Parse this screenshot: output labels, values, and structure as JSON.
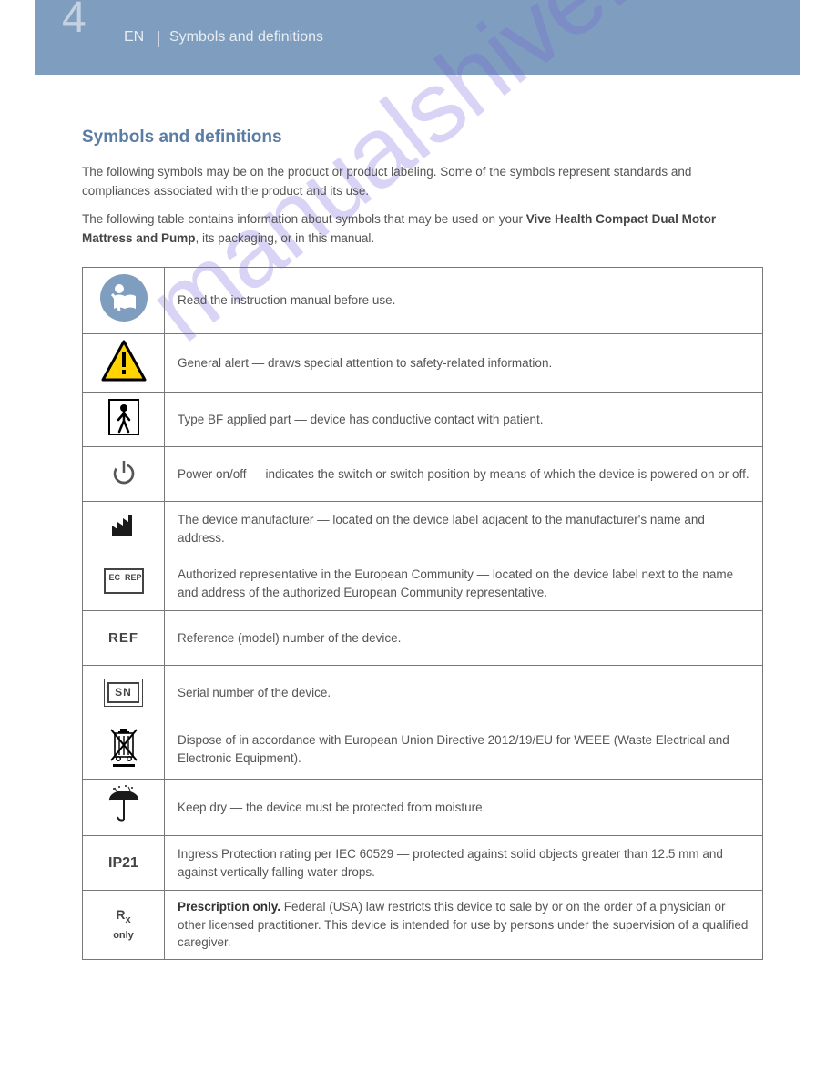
{
  "header": {
    "page_number": "4",
    "left": "EN",
    "right": "Symbols and definitions"
  },
  "intro": {
    "title": "Symbols and definitions",
    "para1": "The following symbols may be on the product or product labeling. Some of the symbols represent standards and compliances associated with the product and its use.",
    "para2_prefix": "The following table contains information about symbols that may be used on your ",
    "product_strong": "Vive Health Compact Dual Motor Mattress and Pump",
    "para2_suffix": ", its packaging, or in this manual."
  },
  "rows": [
    {
      "icon": "manual",
      "text": "Read the instruction manual before use."
    },
    {
      "icon": "alert",
      "text": "General alert — draws special attention to safety-related information."
    },
    {
      "icon": "bf",
      "text": "Type BF applied part — device has conductive contact with patient."
    },
    {
      "icon": "power",
      "text": "Power on/off — indicates the switch or switch position by means of which the device is powered on or off."
    },
    {
      "icon": "mfg",
      "text": "The device manufacturer — located on the device label adjacent to the manufacturer's name and address."
    },
    {
      "icon": "ecrep",
      "text": "Authorized representative in the European Community — located on the device label next to the name and address of the authorized European Community representative."
    },
    {
      "icon": "ref",
      "text": "Reference (model) number of the device."
    },
    {
      "icon": "sn",
      "text": "Serial number of the device."
    },
    {
      "icon": "weee",
      "text": "Dispose of in accordance with European Union Directive 2012/19/EU for WEEE (Waste Electrical and Electronic Equipment)."
    },
    {
      "icon": "dry",
      "text": "Keep dry — the device must be protected from moisture."
    },
    {
      "icon": "ip",
      "text": "Ingress Protection rating per IEC 60529 — protected against solid objects greater than 12.5 mm and against vertically falling water drops."
    },
    {
      "icon": "rx",
      "text_strong": "Prescription only.",
      "text_rest": " Federal (USA) law restricts this device to sale by or on the order of a physician or other licensed practitioner. This device is intended for use by persons under the supervision of a qualified caregiver."
    }
  ],
  "watermark": "manualshive.com"
}
